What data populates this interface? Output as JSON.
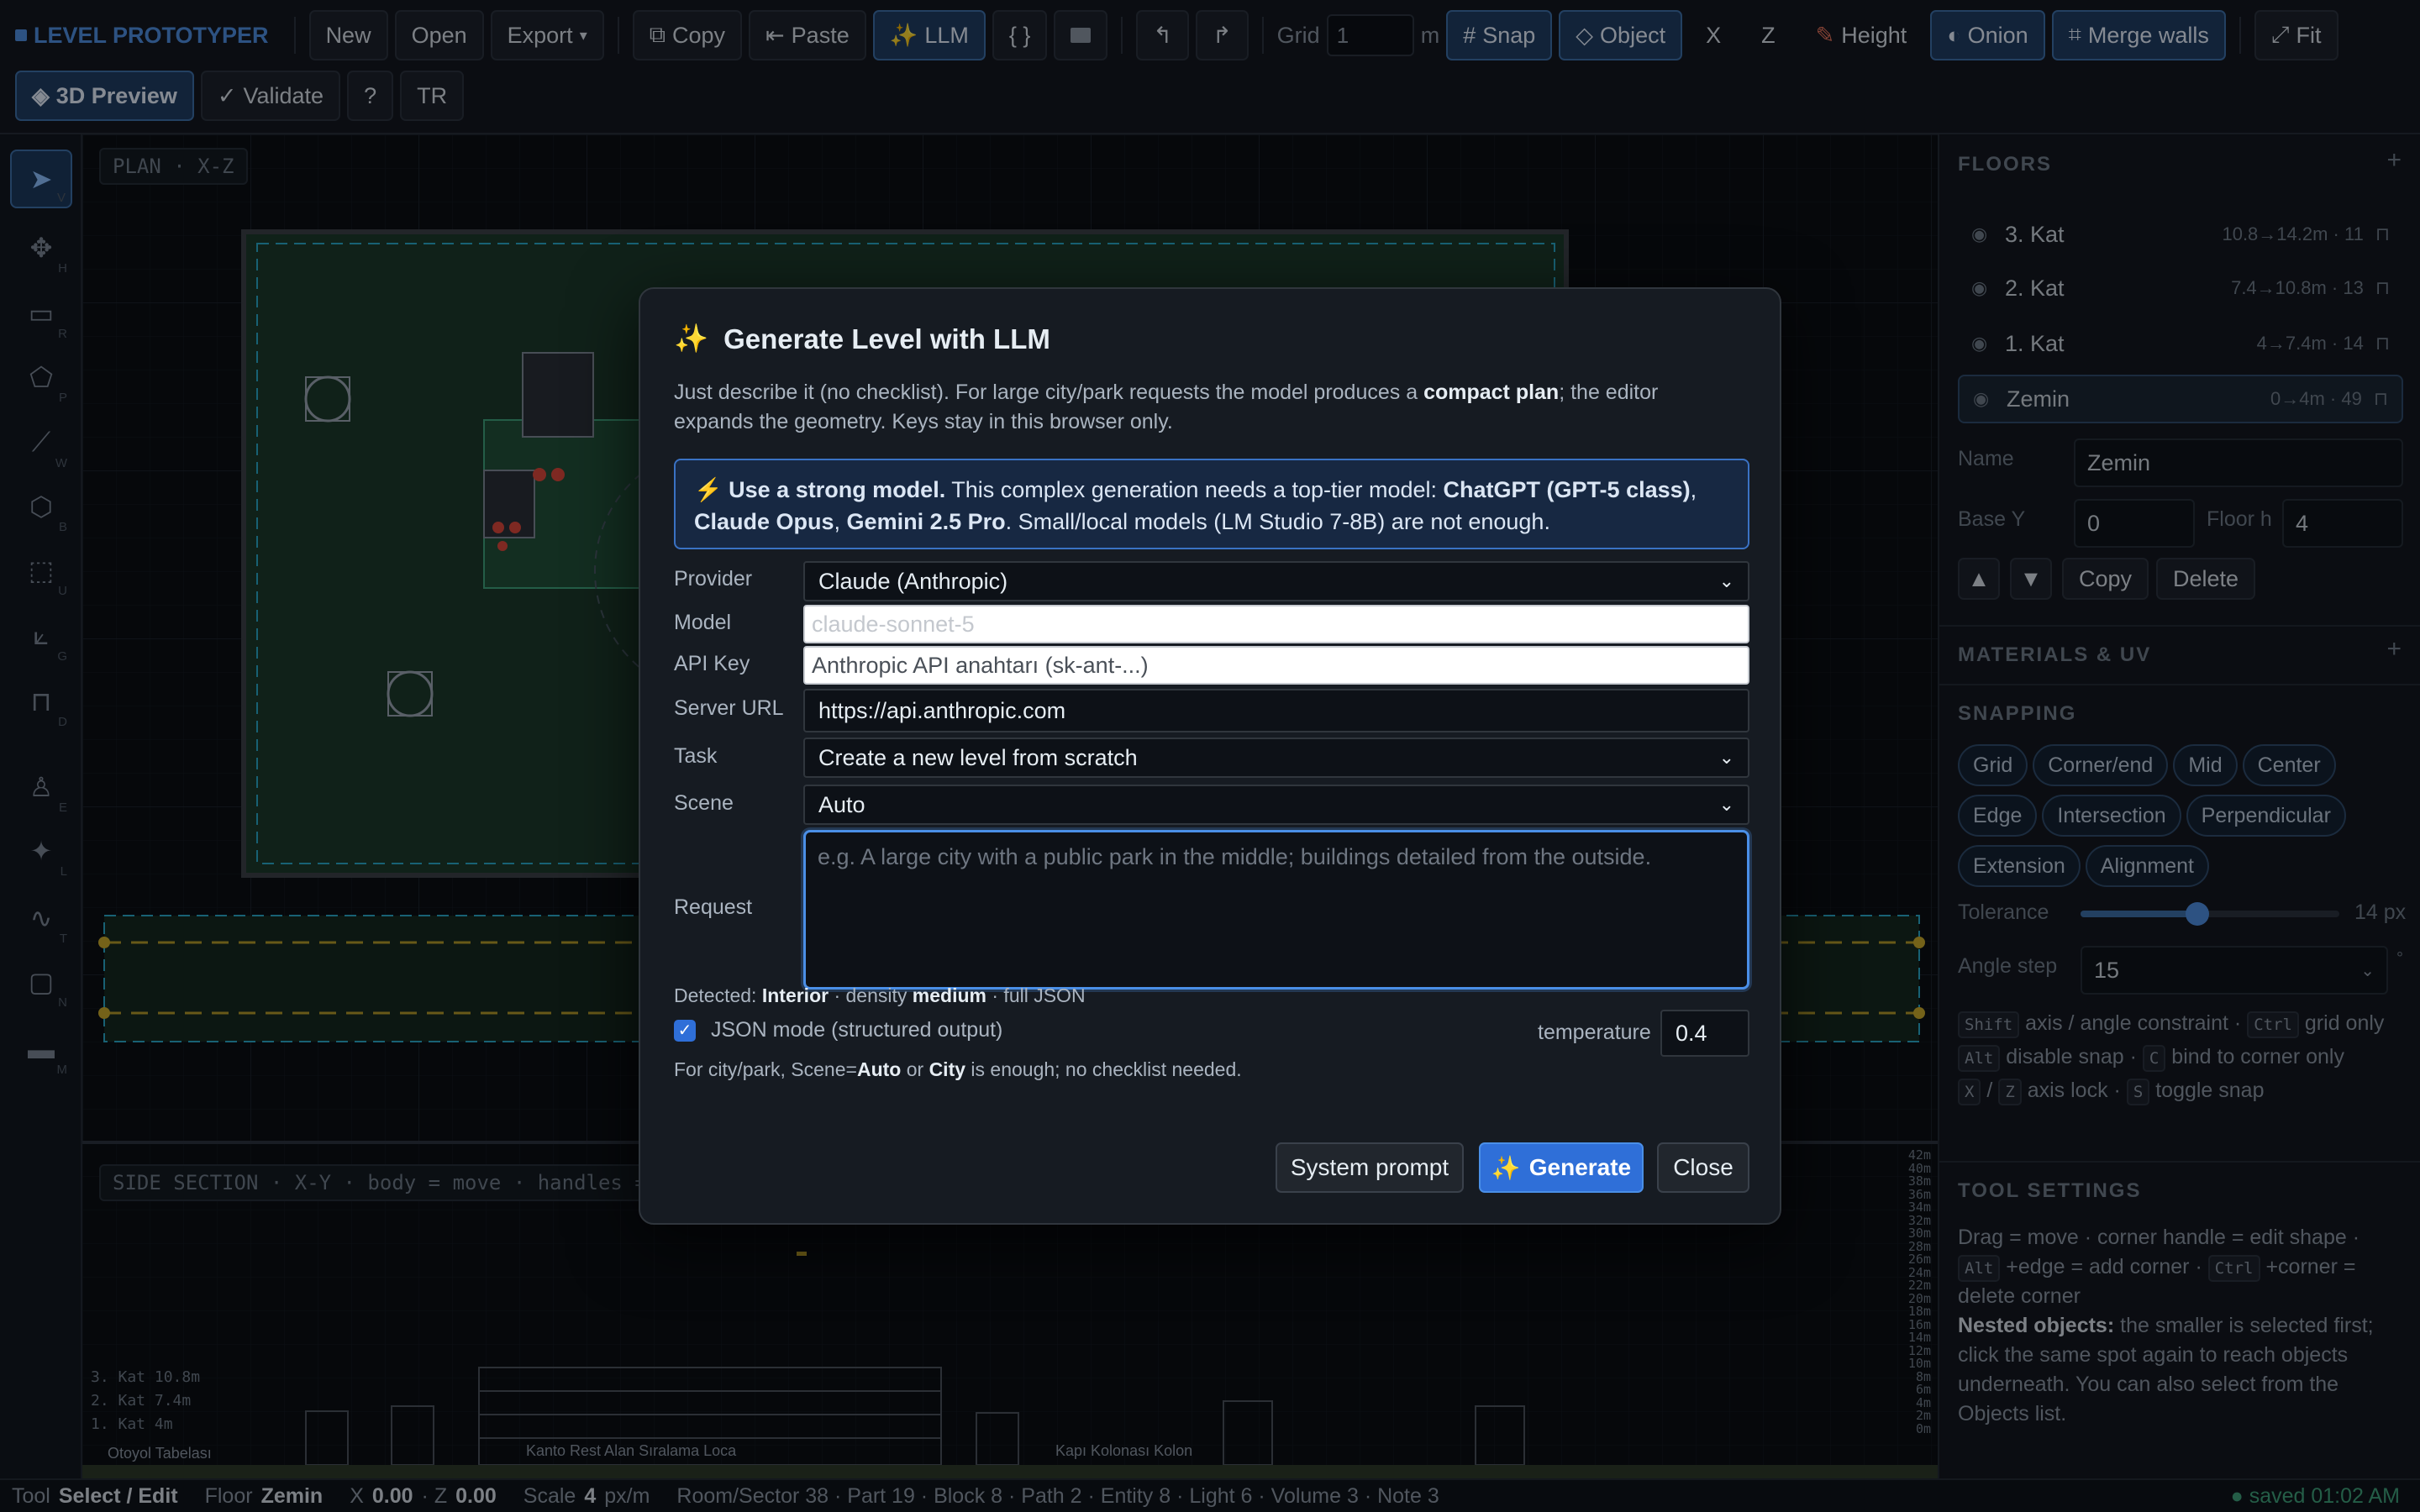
{
  "app": {
    "brand": "LEVEL PROTOTYPER"
  },
  "toolbar": {
    "new": "New",
    "open": "Open",
    "export": "Export",
    "export_caret": "▾",
    "copy": "Copy",
    "paste": "Paste",
    "llm": "LLM",
    "braces": "{ }",
    "grid_label": "Grid",
    "grid_value": "1",
    "grid_unit": "m",
    "snap": "Snap",
    "object": "Object",
    "x": "X",
    "z": "Z",
    "height": "Height",
    "onion": "Onion",
    "merge_walls": "Merge walls",
    "fit": "Fit",
    "preview3d": "3D Preview",
    "validate": "Validate",
    "help": "?",
    "lang": "TR"
  },
  "rail": {
    "tools": [
      {
        "name": "select",
        "key": "V",
        "icon": "cursor-icon"
      },
      {
        "name": "move",
        "key": "H",
        "icon": "move-icon"
      },
      {
        "name": "room",
        "key": "R",
        "icon": "rectangle-icon"
      },
      {
        "name": "polygon",
        "key": "P",
        "icon": "polygon-icon"
      },
      {
        "name": "wall",
        "key": "W",
        "icon": "wall-icon"
      },
      {
        "name": "block",
        "key": "B",
        "icon": "cube-icon"
      },
      {
        "name": "volume",
        "key": "U",
        "icon": "dashed-square-icon"
      },
      {
        "name": "grade",
        "key": "G",
        "icon": "ramp-icon"
      },
      {
        "name": "door",
        "key": "D",
        "icon": "door-icon"
      },
      {
        "name": "entity",
        "key": "E",
        "icon": "person-icon"
      },
      {
        "name": "light",
        "key": "L",
        "icon": "bulb-icon"
      },
      {
        "name": "path",
        "key": "T",
        "icon": "path-icon"
      },
      {
        "name": "note",
        "key": "N",
        "icon": "note-icon"
      },
      {
        "name": "measure",
        "key": "M",
        "icon": "ruler-icon"
      }
    ]
  },
  "canvas": {
    "plan_label": "PLAN · X-Z",
    "side_label": "SIDE SECTION · X-Y · body = move · handles = resize · S",
    "side_levels": [
      "3. Kat  10.8m",
      "2. Kat  7.4m",
      "1. Kat  4m"
    ],
    "bottom_labels": [
      "Otoyol Tabelası",
      "Kanto Rest Alan Sıralama Loca",
      "Kapı Kolonası Kolon"
    ],
    "scale_ticks": [
      "42m",
      "40m",
      "38m",
      "36m",
      "34m",
      "32m",
      "30m",
      "28m",
      "26m",
      "24m",
      "22m",
      "20m",
      "18m",
      "16m",
      "14m",
      "12m",
      "10m",
      "8m",
      "6m",
      "4m",
      "2m",
      "0m"
    ]
  },
  "panel": {
    "floors_title": "FLOORS",
    "floors": [
      {
        "name": "3. Kat",
        "range": "10.8→14.2m · 11",
        "selected": false
      },
      {
        "name": "2. Kat",
        "range": "7.4→10.8m · 13",
        "selected": false
      },
      {
        "name": "1. Kat",
        "range": "4→7.4m · 14",
        "selected": false
      },
      {
        "name": "Zemin",
        "range": "0→4m · 49",
        "selected": true
      }
    ],
    "name_label": "Name",
    "name_value": "Zemin",
    "basey_label": "Base Y",
    "basey_value": "0",
    "floorh_label": "Floor h",
    "floorh_value": "4",
    "copy": "Copy",
    "delete": "Delete",
    "materials_title": "MATERIALS & UV",
    "snapping_title": "SNAPPING",
    "snap_chips": [
      "Grid",
      "Corner/end",
      "Mid",
      "Center",
      "Edge",
      "Intersection",
      "Perpendicular",
      "Extension",
      "Alignment"
    ],
    "tolerance_label": "Tolerance",
    "tolerance_value": "14 px",
    "tolerance_level": 0.45,
    "angle_label": "Angle step",
    "angle_value": "15",
    "angle_unit": "°",
    "hint1a": "axis / angle constraint ·",
    "hint1b": "grid only",
    "hint2a": "disable snap ·",
    "hint2b": "bind to corner only",
    "hint3a": "/",
    "hint3b": "axis lock ·",
    "hint3c": "toggle snap",
    "kbd_shift": "Shift",
    "kbd_ctrl": "Ctrl",
    "kbd_alt": "Alt",
    "kbd_c": "C",
    "kbd_x": "X",
    "kbd_z": "Z",
    "kbd_s": "S",
    "tool_title": "TOOL SETTINGS",
    "tool_line1": "Drag = move · corner handle = edit shape ·",
    "tool_line2a": "+edge = add corner ·",
    "tool_line2b": "+corner =",
    "tool_line3": "delete corner",
    "nested_bold": "Nested objects:",
    "nested_text": "the smaller is selected first; click the same spot again to reach objects underneath. You can also select from the Objects list."
  },
  "status": {
    "tool_label": "Tool",
    "tool_value": "Select / Edit",
    "floor_label": "Floor",
    "floor_value": "Zemin",
    "x_label": "X",
    "x_value": "0.00",
    "z_label": "· Z",
    "z_value": "0.00",
    "scale_label": "Scale",
    "scale_value": "4",
    "scale_unit": "px/m",
    "counts": "Room/Sector 38 · Part 19 · Block 8 · Path 2 · Entity 8 · Light 6 · Volume 3 · Note 3",
    "saved": "● saved 01:02 AM"
  },
  "modal": {
    "title": "Generate Level with LLM",
    "desc_a": "Just describe it (no checklist). For large city/park requests the model produces a",
    "desc_bold": "compact plan",
    "desc_b": "; the editor expands the geometry. Keys stay in this browser only.",
    "warn_bold": "Use a strong model.",
    "warn_a": "This complex generation needs a top-tier model:",
    "warn_m1": "ChatGPT (GPT-5 class)",
    "warn_m2": "Claude Opus",
    "warn_m3": "Gemini 2.5 Pro",
    "warn_b": ". Small/local models (LM Studio 7-8B) are not enough.",
    "provider_label": "Provider",
    "provider_value": "Claude (Anthropic)",
    "model_label": "Model",
    "model_placeholder": "claude-sonnet-5",
    "apikey_label": "API Key",
    "apikey_placeholder": "Anthropic API anahtarı (sk-ant-...)",
    "server_label": "Server URL",
    "server_value": "https://api.anthropic.com",
    "task_label": "Task",
    "task_value": "Create a new level from scratch",
    "scene_label": "Scene",
    "scene_value": "Auto",
    "request_label": "Request",
    "request_placeholder": "e.g. A large city with a public park in the middle; buildings detailed from the outside.",
    "detected_a": "Detected:",
    "detected_b": "Interior",
    "detected_c": "· density",
    "detected_d": "medium",
    "detected_e": "· full JSON",
    "json_mode": "JSON mode (structured output)",
    "json_checked": true,
    "temp_label": "temperature",
    "temp_value": "0.4",
    "note_a": "For city/park, Scene=",
    "note_b": "Auto",
    "note_c": " or ",
    "note_d": "City",
    "note_e": " is enough; no checklist needed.",
    "btn_system": "System prompt",
    "btn_generate": "Generate",
    "btn_close": "Close"
  },
  "colors": {
    "accent": "#2f6fd8",
    "warn_border": "#3a72c4",
    "focus": "#4a8fe7"
  }
}
